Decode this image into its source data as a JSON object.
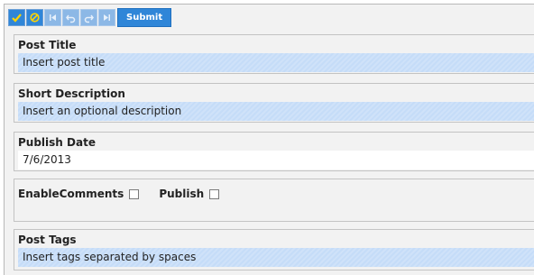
{
  "toolbar": {
    "submit_label": "Submit",
    "buttons": [
      {
        "icon": "check-icon",
        "enabled": true
      },
      {
        "icon": "cancel-icon",
        "enabled": true
      },
      {
        "icon": "first-page-icon",
        "enabled": false
      },
      {
        "icon": "undo-icon",
        "enabled": false
      },
      {
        "icon": "redo-icon",
        "enabled": false
      },
      {
        "icon": "last-page-icon",
        "enabled": false
      }
    ],
    "accent_color": "#2f86d8"
  },
  "form": {
    "post_title": {
      "label": "Post Title",
      "value": "Insert post title"
    },
    "short_description": {
      "label": "Short Description",
      "value": "Insert an optional description"
    },
    "publish_date": {
      "label": "Publish Date",
      "value": "7/6/2013"
    },
    "enable_comments": {
      "label": "EnableComments",
      "checked": false
    },
    "publish": {
      "label": "Publish",
      "checked": false
    },
    "post_tags": {
      "label": "Post Tags",
      "value": "Insert tags separated by spaces"
    }
  }
}
